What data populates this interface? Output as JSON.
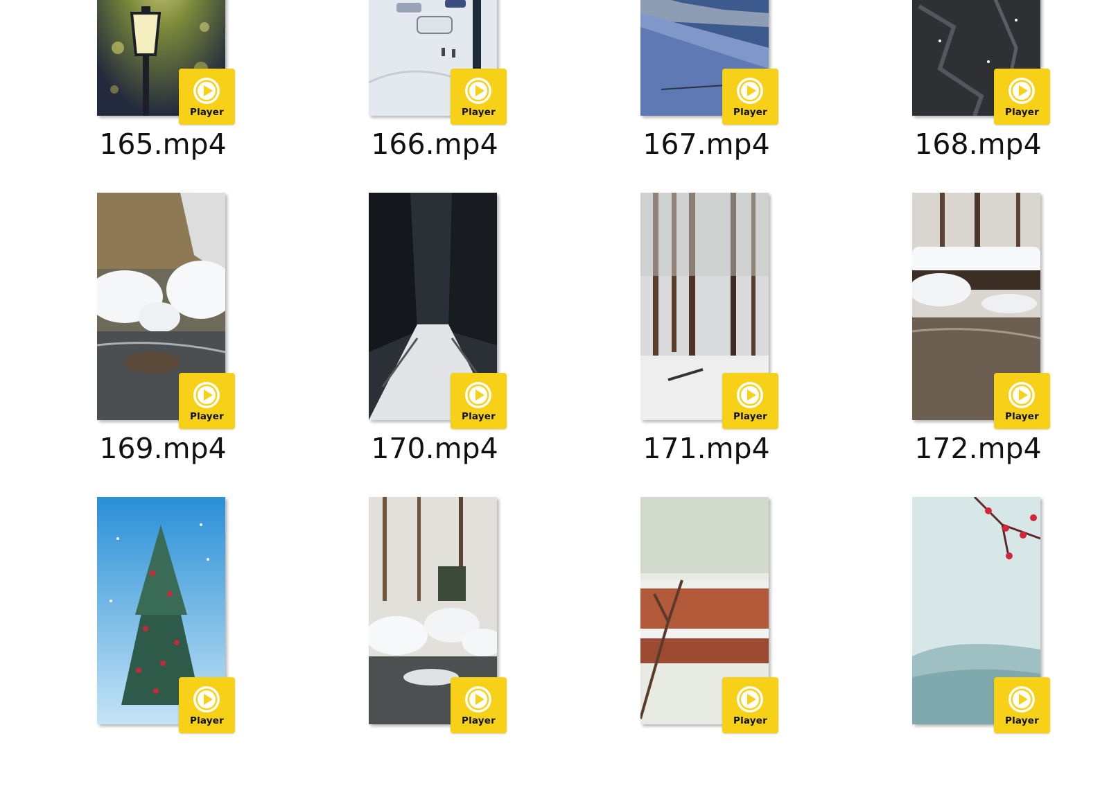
{
  "badge_text": "Player",
  "colors": {
    "badge": "#f7d117",
    "background": "#ffffff",
    "label": "#111111"
  },
  "files": [
    {
      "name": "165.mp4",
      "scene": "lamp",
      "icon": "play-icon"
    },
    {
      "name": "166.mp4",
      "scene": "parking",
      "icon": "play-icon"
    },
    {
      "name": "167.mp4",
      "scene": "slope",
      "icon": "play-icon"
    },
    {
      "name": "168.mp4",
      "scene": "rock",
      "icon": "play-icon"
    },
    {
      "name": "169.mp4",
      "scene": "stream-snow",
      "icon": "play-icon"
    },
    {
      "name": "170.mp4",
      "scene": "dark-path",
      "icon": "play-icon"
    },
    {
      "name": "171.mp4",
      "scene": "pine-forest",
      "icon": "play-icon"
    },
    {
      "name": "172.mp4",
      "scene": "creek-log",
      "icon": "play-icon"
    },
    {
      "name": "",
      "scene": "christmas-tree",
      "icon": "play-icon"
    },
    {
      "name": "",
      "scene": "snow-rocks",
      "icon": "play-icon"
    },
    {
      "name": "",
      "scene": "wall-branch",
      "icon": "play-icon"
    },
    {
      "name": "",
      "scene": "plum-blossom",
      "icon": "play-icon"
    }
  ]
}
